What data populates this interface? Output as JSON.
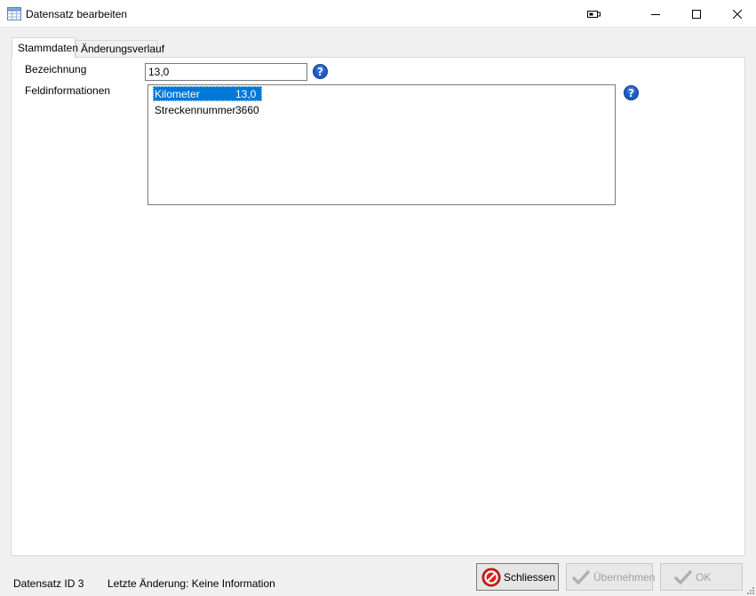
{
  "window": {
    "title": "Datensatz bearbeiten",
    "icon": "table-icon"
  },
  "titlebar_buttons": [
    "extra-icon",
    "minimize-icon",
    "maximize-icon",
    "close-icon"
  ],
  "tabs": [
    {
      "label": "Stammdaten",
      "active": true
    },
    {
      "label": "Änderungsverlauf",
      "active": false
    }
  ],
  "form": {
    "bezeichnung_label": "Bezeichnung",
    "bezeichnung_value": "13,0",
    "feldinfo_label": "Feldinformationen",
    "feldinfo_rows": [
      {
        "name": "Kilometer",
        "value": "13,0",
        "selected": true
      },
      {
        "name": "Streckennummer",
        "value": "3660",
        "selected": false
      }
    ]
  },
  "status": {
    "record_id": "Datensatz ID 3",
    "last_change": "Letzte Änderung: Keine Information"
  },
  "buttons": {
    "close_label": "Schliessen",
    "apply_label": "Übernehmen",
    "ok_label": "OK"
  },
  "colors": {
    "selection": "#0078d7",
    "help_icon": "#1e5bc6",
    "close_button_icon": "#d9201b",
    "disabled_text": "#a0a0a0"
  }
}
